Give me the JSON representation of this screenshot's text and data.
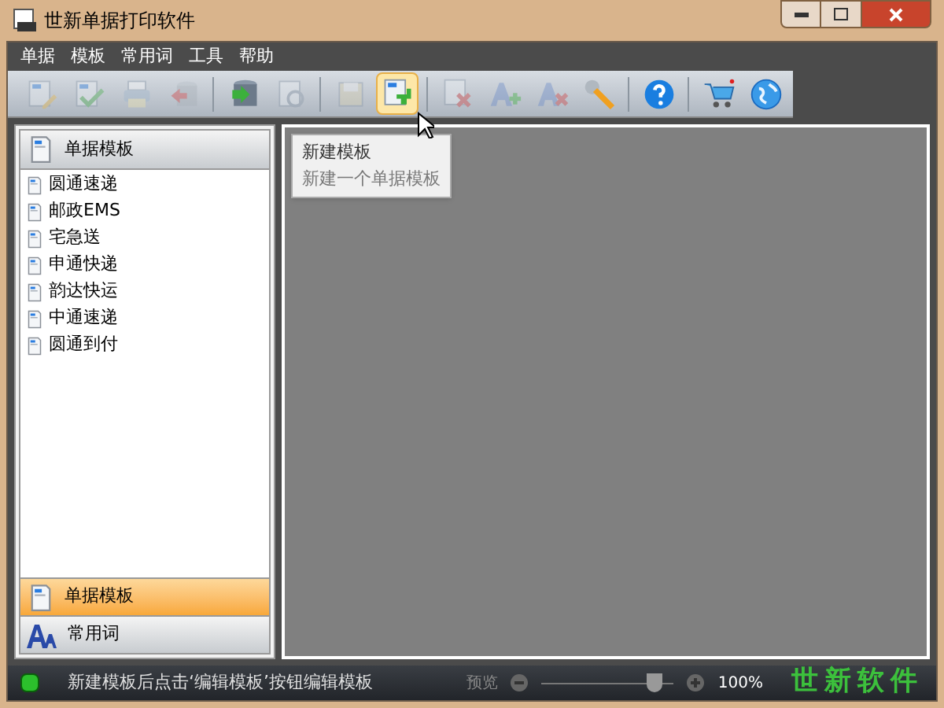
{
  "window": {
    "title": "世新单据打印软件"
  },
  "menu": [
    "单据",
    "模板",
    "常用词",
    "工具",
    "帮助"
  ],
  "toolbar": [
    {
      "disabled": true,
      "selected": false
    },
    {
      "disabled": true,
      "selected": false
    },
    {
      "disabled": true,
      "selected": false
    },
    {
      "disabled": true,
      "selected": false
    },
    {
      "disabled": false,
      "selected": false
    },
    {
      "disabled": true,
      "selected": false
    },
    {
      "disabled": true,
      "selected": false
    },
    {
      "disabled": false,
      "selected": true
    },
    {
      "disabled": true,
      "selected": false
    },
    {
      "disabled": true,
      "selected": false
    },
    {
      "disabled": true,
      "selected": false
    },
    {
      "disabled": false,
      "selected": false
    },
    {
      "disabled": false,
      "selected": false
    },
    {
      "disabled": false,
      "selected": false
    },
    {
      "disabled": false,
      "selected": false
    }
  ],
  "tooltip": {
    "title": "新建模板",
    "text": "新建一个单据模板"
  },
  "sidebar": {
    "header": "单据模板",
    "items": [
      "圆通速递",
      "邮政EMS",
      "宅急送",
      "申通快递",
      "韵达快运",
      "中通速递",
      "圆通到付"
    ],
    "sections": [
      {
        "label": "单据模板",
        "selected": true
      },
      {
        "label": "常用词",
        "selected": false
      }
    ]
  },
  "status_bar": {
    "message": "新建模板后点击‘编辑模板’按钮编辑模板",
    "zoom_label": "预览",
    "zoom": {
      "level": 0.85
    },
    "zoom_value": "100%",
    "logo": "世新软件"
  }
}
